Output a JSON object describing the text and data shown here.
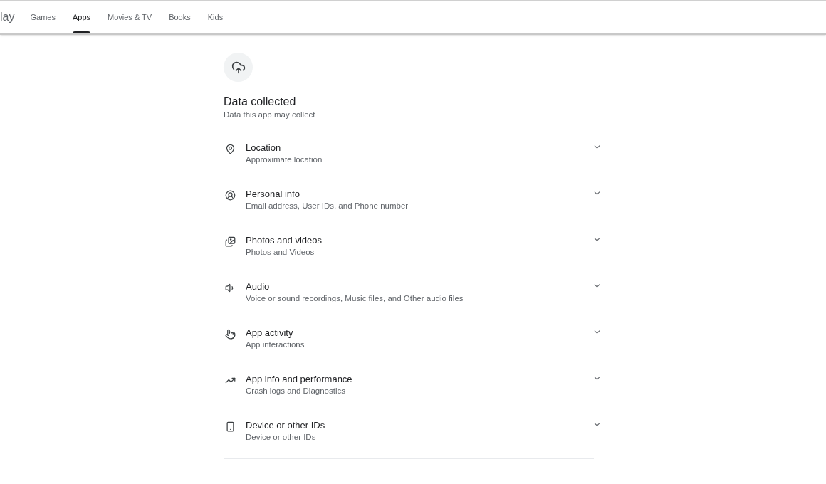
{
  "header": {
    "logo_text": "lay",
    "tabs": [
      {
        "label": "Games",
        "selected": false
      },
      {
        "label": "Apps",
        "selected": true
      },
      {
        "label": "Movies & TV",
        "selected": false
      },
      {
        "label": "Books",
        "selected": false
      },
      {
        "label": "Kids",
        "selected": false
      }
    ]
  },
  "section": {
    "title": "Data collected",
    "subtitle": "Data this app may collect",
    "items": [
      {
        "title": "Location",
        "detail": "Approximate location",
        "expanded": false
      },
      {
        "title": "Personal info",
        "detail": "Email address, User IDs, and Phone number",
        "expanded": false
      },
      {
        "title": "Photos and videos",
        "detail": "Photos and Videos",
        "expanded": false
      },
      {
        "title": "Audio",
        "detail": "Voice or sound recordings, Music files, and Other audio files",
        "expanded": false
      },
      {
        "title": "App activity",
        "detail": "App interactions",
        "expanded": false
      },
      {
        "title": "App info and performance",
        "detail": "Crash logs and Diagnostics",
        "expanded": false
      },
      {
        "title": "Device or other IDs",
        "detail": "Device or other IDs",
        "expanded": false
      }
    ]
  }
}
